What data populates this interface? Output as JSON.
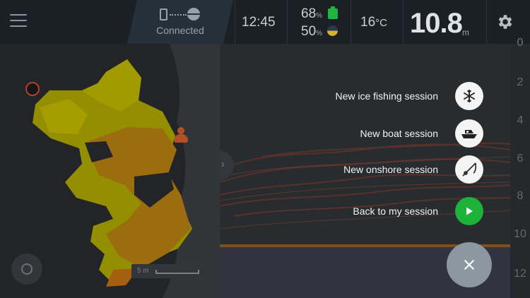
{
  "topbar": {
    "connection_label": "Connected",
    "time": "12:45",
    "battery_phone_value": "68",
    "battery_phone_unit": "%",
    "battery_deeper_value": "50",
    "battery_deeper_unit": "%",
    "temperature_value": "16",
    "temperature_unit": "°C",
    "depth_value": "10.8",
    "depth_unit": "m"
  },
  "map": {
    "scale_label": "5 m"
  },
  "sonar": {
    "depth_ticks": [
      "0",
      "2",
      "4",
      "6",
      "8",
      "10",
      "12"
    ]
  },
  "session_menu": {
    "items": [
      {
        "label": "New ice fishing session",
        "icon": "snowflake-icon"
      },
      {
        "label": "New boat session",
        "icon": "boat-icon"
      },
      {
        "label": "New onshore session",
        "icon": "fishing-rod-icon"
      },
      {
        "label": "Back to my session",
        "icon": "play-icon"
      }
    ],
    "close_icon": "close-icon"
  },
  "colors": {
    "topbar_bg": "#1b2026",
    "accent_green": "#1db23a",
    "map_yellow": "#d4c400",
    "map_orange": "#d98a12",
    "fab_grey": "#8d979f"
  }
}
